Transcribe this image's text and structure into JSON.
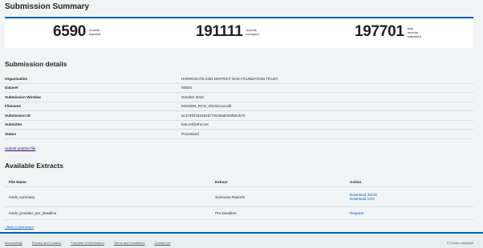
{
  "page_title": "Submission Summary",
  "stats": [
    {
      "number": "6590",
      "label": [
        "records",
        "rejected"
      ]
    },
    {
      "number": "191111",
      "label": [
        "records",
        "accepted"
      ]
    },
    {
      "number": "197701",
      "label": [
        "total",
        "records",
        "submitted"
      ]
    }
  ],
  "details": {
    "heading": "Submission details",
    "rows": [
      {
        "key": "Organisation",
        "value": "HARROGATE AND DISTRICT NHS FOUNDATION TRUST"
      },
      {
        "key": "Dataset",
        "value": "MSDS"
      },
      {
        "key": "Submission Window",
        "value": "October 2019"
      },
      {
        "key": "Filename",
        "value": "MS250M_RCD_201910.accdb"
      },
      {
        "key": "Submission ID",
        "value": "ac174fcf4323d4d779c82a6f480b6cb70"
      },
      {
        "key": "Submitter",
        "value": "test.ref@nhs.net"
      },
      {
        "key": "Status",
        "value": "Processed"
      }
    ],
    "submit_another": "Submit another file"
  },
  "extracts": {
    "heading": "Available Extracts",
    "columns": [
      "File Name",
      "Extract",
      "Action"
    ],
    "rows": [
      {
        "file": "msds_summary",
        "extract": "Summary Reports",
        "actions": [
          "Download JSON",
          "Download CSV"
        ]
      },
      {
        "file": "msds_provider_pre_deadline",
        "extract": "Pre Deadline",
        "actions": [
          "Request"
        ]
      }
    ]
  },
  "back_link": "‹ Back to dashboard",
  "footer": {
    "links": [
      "Accessibility",
      "Privacy and Cookies",
      "Freedom of Information",
      "Terms and Conditions",
      "Contact Us"
    ],
    "copyright": "© Crown copyright"
  }
}
